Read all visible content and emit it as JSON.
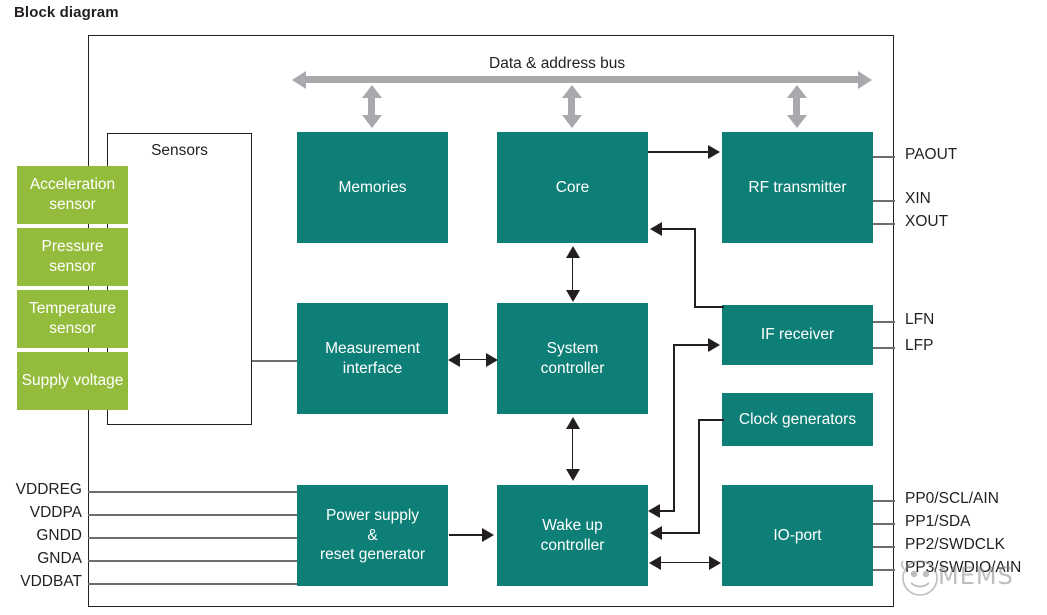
{
  "page": {
    "title": "Block diagram"
  },
  "bus": {
    "label": "Data & address bus"
  },
  "sensors": {
    "title": "Sensors",
    "items": [
      {
        "label": "Acceleration sensor",
        "line1": "Acceleration",
        "line2": "sensor"
      },
      {
        "label": "Pressure sensor",
        "line1": "Pressure",
        "line2": "sensor"
      },
      {
        "label": "Temperature sensor",
        "line1": "Temperature",
        "line2": "sensor"
      },
      {
        "label": "Supply voltage",
        "line1": "Supply",
        "line2": "voltage"
      }
    ]
  },
  "blocks": {
    "memories": {
      "line1": "Memories"
    },
    "core": {
      "line1": "Core"
    },
    "rf_transmitter": {
      "line1": "RF transmitter"
    },
    "measurement_interface": {
      "line1": "Measurement",
      "line2": "interface"
    },
    "system_controller": {
      "line1": "System",
      "line2": "controller"
    },
    "if_receiver": {
      "line1": "IF receiver"
    },
    "clock_generators": {
      "line1": "Clock generators"
    },
    "power_supply": {
      "line1": "Power supply",
      "line2": "&",
      "line3": "reset generator"
    },
    "wake_up_controller": {
      "line1": "Wake up",
      "line2": "controller"
    },
    "io_port": {
      "line1": "IO-port"
    }
  },
  "pins": {
    "left": [
      {
        "label": "VDDREG"
      },
      {
        "label": "VDDPA"
      },
      {
        "label": "GNDD"
      },
      {
        "label": "GNDA"
      },
      {
        "label": "VDDBAT"
      }
    ],
    "right": [
      {
        "label": "PAOUT"
      },
      {
        "label": "XIN"
      },
      {
        "label": "XOUT"
      },
      {
        "label": "LFN"
      },
      {
        "label": "LFP"
      },
      {
        "label": "PP0/SCL/AIN"
      },
      {
        "label": "PP1/SDA"
      },
      {
        "label": "PP2/SWDCLK"
      },
      {
        "label": "PP3/SWDIO/AIN"
      }
    ]
  },
  "watermark": {
    "text": "MEMS"
  },
  "colors": {
    "block_teal": "#0d7f77",
    "sensor_green": "#94bc3c",
    "bus_grey": "#a7a9ac",
    "wire_grey": "#6d6e71",
    "ink": "#231f20"
  }
}
